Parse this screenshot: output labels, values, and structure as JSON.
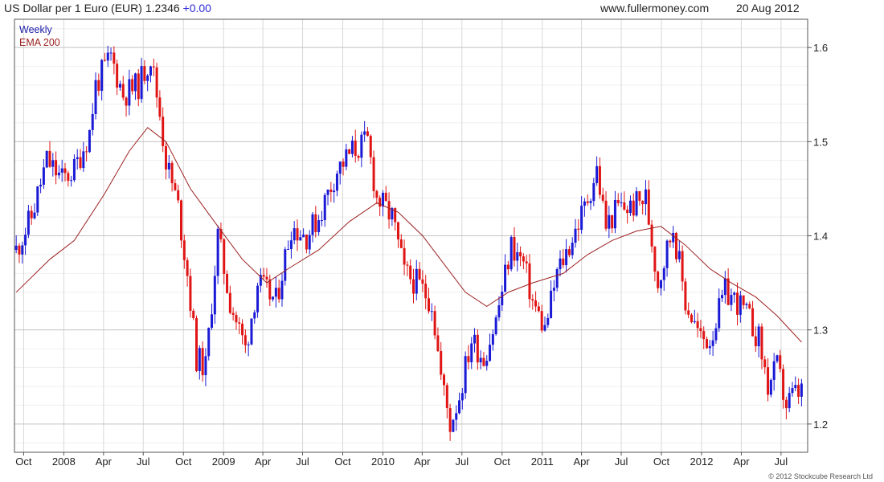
{
  "header": {
    "title": "US Dollar per 1 Euro (EUR) 1.2346",
    "change": "+0.00",
    "site": "www.fullermoney.com",
    "date": "20 Aug 2012"
  },
  "copyright": "© 2012 Stockcube Research Ltd",
  "colors": {
    "up": "#1a1ad6",
    "down": "#e01414",
    "ema": "#9c2020",
    "grid": "#d8d8d8",
    "minor_grid": "#efefef",
    "axis": "#555555"
  },
  "chart_data": {
    "type": "candlestick",
    "series": [
      {
        "name": "Weekly",
        "interval": "weekly"
      },
      {
        "name": "EMA 200",
        "type": "line"
      }
    ],
    "y_ticks": [
      1.2,
      1.3,
      1.4,
      1.5,
      1.6
    ],
    "ylim": [
      1.17,
      1.63
    ],
    "y_axis_side": "right",
    "x_tick_labels": [
      "Oct",
      "2008",
      "Apr",
      "Jul",
      "Oct",
      "2009",
      "Apr",
      "Jul",
      "Oct",
      "2010",
      "Apr",
      "Jul",
      "Oct",
      "2011",
      "Apr",
      "Jul",
      "Oct",
      "2012",
      "Apr",
      "Jul"
    ],
    "x_tick_dates": [
      "2007-10-01",
      "2008-01-01",
      "2008-04-01",
      "2008-07-01",
      "2008-10-01",
      "2009-01-01",
      "2009-04-01",
      "2009-07-01",
      "2009-10-01",
      "2010-01-01",
      "2010-04-01",
      "2010-07-01",
      "2010-10-01",
      "2011-01-01",
      "2011-04-01",
      "2011-07-01",
      "2011-10-01",
      "2012-01-01",
      "2012-04-01",
      "2012-07-01"
    ],
    "xlim": [
      "2007-09-10",
      "2012-08-31"
    ],
    "price_path": [
      [
        "2007-09-14",
        1.385
      ],
      [
        "2007-10-19",
        1.42
      ],
      [
        "2007-11-23",
        1.48
      ],
      [
        "2007-12-28",
        1.46
      ],
      [
        "2008-01-25",
        1.47
      ],
      [
        "2008-02-29",
        1.51
      ],
      [
        "2008-03-14",
        1.56
      ],
      [
        "2008-04-18",
        1.59
      ],
      [
        "2008-05-16",
        1.55
      ],
      [
        "2008-06-20",
        1.56
      ],
      [
        "2008-07-18",
        1.59
      ],
      [
        "2008-08-08",
        1.53
      ],
      [
        "2008-08-22",
        1.48
      ],
      [
        "2008-09-19",
        1.43
      ],
      [
        "2008-10-10",
        1.36
      ],
      [
        "2008-10-31",
        1.27
      ],
      [
        "2008-11-21",
        1.26
      ],
      [
        "2008-12-19",
        1.4
      ],
      [
        "2009-01-16",
        1.33
      ],
      [
        "2009-02-20",
        1.28
      ],
      [
        "2009-03-20",
        1.35
      ],
      [
        "2009-05-01",
        1.33
      ],
      [
        "2009-06-05",
        1.41
      ],
      [
        "2009-07-10",
        1.4
      ],
      [
        "2009-08-07",
        1.42
      ],
      [
        "2009-09-18",
        1.47
      ],
      [
        "2009-10-23",
        1.49
      ],
      [
        "2009-11-27",
        1.5
      ],
      [
        "2009-12-18",
        1.44
      ],
      [
        "2010-01-22",
        1.42
      ],
      [
        "2010-02-19",
        1.36
      ],
      [
        "2010-03-19",
        1.35
      ],
      [
        "2010-04-23",
        1.33
      ],
      [
        "2010-05-14",
        1.25
      ],
      [
        "2010-06-04",
        1.2
      ],
      [
        "2010-06-25",
        1.23
      ],
      [
        "2010-07-23",
        1.29
      ],
      [
        "2010-08-20",
        1.27
      ],
      [
        "2010-09-17",
        1.31
      ],
      [
        "2010-10-22",
        1.39
      ],
      [
        "2010-11-19",
        1.37
      ],
      [
        "2010-12-10",
        1.33
      ],
      [
        "2011-01-07",
        1.3
      ],
      [
        "2011-02-04",
        1.36
      ],
      [
        "2011-03-04",
        1.39
      ],
      [
        "2011-04-08",
        1.43
      ],
      [
        "2011-05-06",
        1.47
      ],
      [
        "2011-05-27",
        1.41
      ],
      [
        "2011-06-24",
        1.43
      ],
      [
        "2011-07-22",
        1.43
      ],
      [
        "2011-08-26",
        1.44
      ],
      [
        "2011-09-23",
        1.35
      ],
      [
        "2011-10-28",
        1.41
      ],
      [
        "2011-11-25",
        1.33
      ],
      [
        "2011-12-30",
        1.29
      ],
      [
        "2012-01-20",
        1.29
      ],
      [
        "2012-02-24",
        1.34
      ],
      [
        "2012-03-23",
        1.33
      ],
      [
        "2012-04-20",
        1.31
      ],
      [
        "2012-05-11",
        1.29
      ],
      [
        "2012-06-01",
        1.24
      ],
      [
        "2012-06-22",
        1.26
      ],
      [
        "2012-07-13",
        1.22
      ],
      [
        "2012-07-27",
        1.23
      ],
      [
        "2012-08-17",
        1.2346
      ]
    ],
    "ema_path": [
      [
        "2007-09-14",
        1.34
      ],
      [
        "2007-11-30",
        1.375
      ],
      [
        "2008-01-25",
        1.395
      ],
      [
        "2008-04-04",
        1.445
      ],
      [
        "2008-05-30",
        1.49
      ],
      [
        "2008-07-11",
        1.515
      ],
      [
        "2008-08-22",
        1.5
      ],
      [
        "2008-10-17",
        1.45
      ],
      [
        "2008-12-19",
        1.41
      ],
      [
        "2009-02-13",
        1.375
      ],
      [
        "2009-04-10",
        1.35
      ],
      [
        "2009-05-29",
        1.365
      ],
      [
        "2009-08-07",
        1.385
      ],
      [
        "2009-10-16",
        1.415
      ],
      [
        "2009-12-18",
        1.435
      ],
      [
        "2010-02-05",
        1.425
      ],
      [
        "2010-04-02",
        1.4
      ],
      [
        "2010-05-21",
        1.37
      ],
      [
        "2010-07-09",
        1.34
      ],
      [
        "2010-08-27",
        1.325
      ],
      [
        "2010-10-15",
        1.34
      ],
      [
        "2010-12-10",
        1.35
      ],
      [
        "2011-02-18",
        1.36
      ],
      [
        "2011-04-15",
        1.38
      ],
      [
        "2011-06-10",
        1.395
      ],
      [
        "2011-08-05",
        1.405
      ],
      [
        "2011-09-30",
        1.41
      ],
      [
        "2011-11-25",
        1.39
      ],
      [
        "2012-01-20",
        1.365
      ],
      [
        "2012-03-09",
        1.35
      ],
      [
        "2012-05-04",
        1.335
      ],
      [
        "2012-06-22",
        1.315
      ],
      [
        "2012-08-17",
        1.287
      ]
    ]
  }
}
